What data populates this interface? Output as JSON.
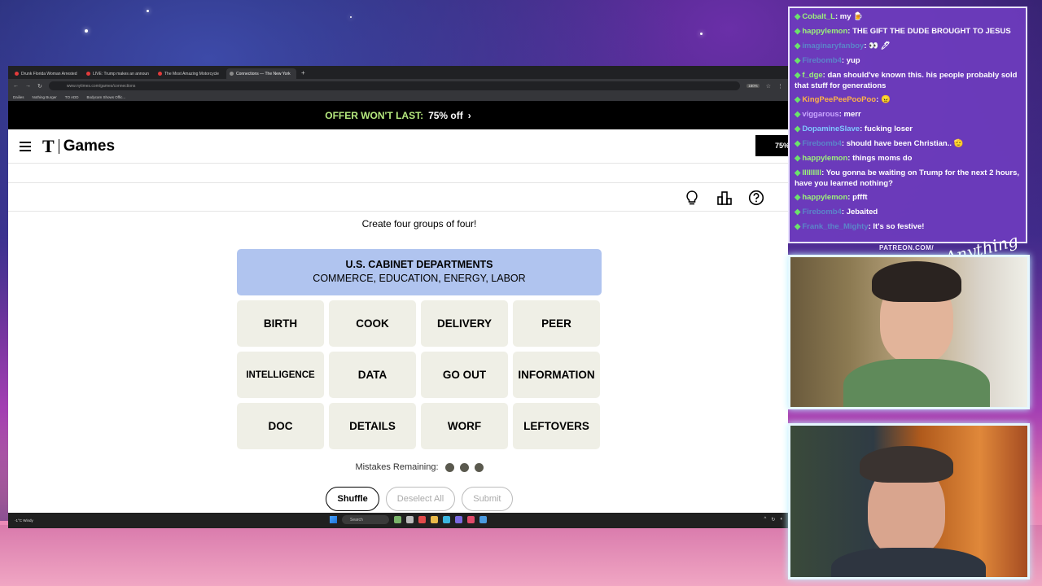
{
  "browser": {
    "tabs": [
      {
        "title": "Drunk Florida Woman Arrested",
        "active": false
      },
      {
        "title": "LIVE: Trump makes an announ",
        "active": false
      },
      {
        "title": "The Most Amazing Motorcycle",
        "active": false
      },
      {
        "title": "Connections — The New York",
        "active": true
      }
    ],
    "url": "www.nytimes.com/games/connections",
    "zoom": "180%",
    "bookmarks": [
      "Dailies",
      "Nothing Burger",
      "TO ADD",
      "Bodycam Shows Offic..."
    ]
  },
  "offer": {
    "label": "OFFER WON'T LAST:",
    "discount": "75% off",
    "chevron": "›"
  },
  "header": {
    "logo_t": "T",
    "logo_text": "Games",
    "subscribe_label": "75%"
  },
  "game": {
    "instruction": "Create four groups of four!",
    "solved_group": {
      "category": "U.S. CABINET DEPARTMENTS",
      "words": "COMMERCE, EDUCATION, ENERGY, LABOR",
      "color": "#b0c4ef"
    },
    "tiles": [
      "BIRTH",
      "COOK",
      "DELIVERY",
      "PEER",
      "INTELLIGENCE",
      "DATA",
      "GO OUT",
      "INFORMATION",
      "DOC",
      "DETAILS",
      "WORF",
      "LEFTOVERS"
    ],
    "mistakes_label": "Mistakes Remaining:",
    "mistakes_remaining": 3,
    "buttons": {
      "shuffle": "Shuffle",
      "deselect": "Deselect All",
      "submit": "Submit"
    }
  },
  "taskbar": {
    "weather": "-1°C Windy",
    "search_placeholder": "Search"
  },
  "chat": {
    "messages": [
      {
        "user": "Cobalt_L",
        "text": "my 🍺",
        "color": "u-green"
      },
      {
        "user": "happylemon",
        "text": "THE GIFT THE DUDE BROUGHT TO JESUS",
        "color": "u-green"
      },
      {
        "user": "imaginaryfanboy",
        "text": "👀 🖊",
        "color": "u-dim"
      },
      {
        "user": "Firebomb4",
        "text": "yup",
        "color": "u-dim"
      },
      {
        "user": "f_dge",
        "text": "dan should've known this. his people probably sold that stuff for generations",
        "color": "u-green"
      },
      {
        "user": "KingPeePeePooPoo",
        "text": "😠",
        "color": "u-orange"
      },
      {
        "user": "viggarous",
        "text": "merr",
        "color": "u-purple"
      },
      {
        "user": "DopamineSlave",
        "text": "fucking loser",
        "color": "u-blue"
      },
      {
        "user": "Firebomb4",
        "text": "should have been Christian.. 🫡",
        "color": "u-dim"
      },
      {
        "user": "happylemon",
        "text": "things moms do",
        "color": "u-green"
      },
      {
        "user": "IIIIIIIII",
        "text": "You gonna be waiting on Trump for the next 2 hours, have you learned nothing?",
        "color": "u-green"
      },
      {
        "user": "happylemon",
        "text": "pffft",
        "color": "u-green"
      },
      {
        "user": "Firebomb4",
        "text": "Jebaited",
        "color": "u-dim"
      },
      {
        "user": "Frank_the_Mighty",
        "text": "It's so festive!",
        "color": "u-dim"
      }
    ]
  },
  "overlay": {
    "patreon": "PATREON.COM/",
    "signature": "Anything"
  }
}
